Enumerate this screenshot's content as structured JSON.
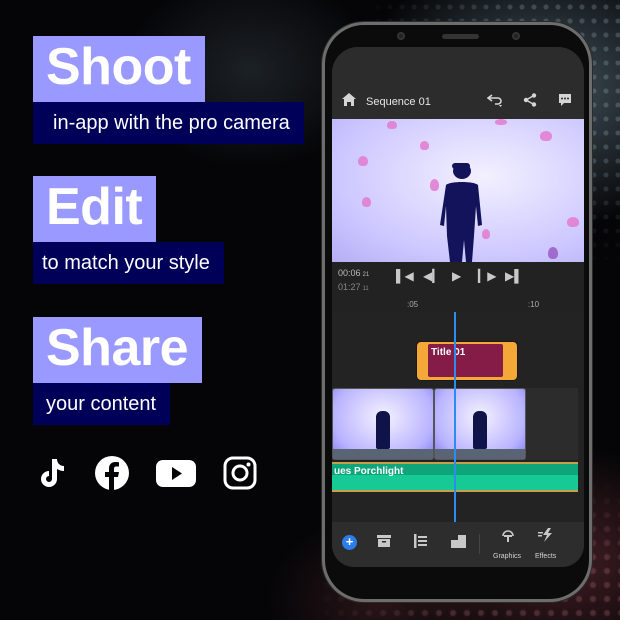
{
  "promo": {
    "shoot": {
      "headline": "Shoot",
      "sub": "in-app with the pro camera"
    },
    "edit": {
      "headline": "Edit",
      "sub": "to match your style"
    },
    "share": {
      "headline": "Share",
      "sub": "your content"
    },
    "social_icons": [
      "tiktok-icon",
      "facebook-icon",
      "youtube-icon",
      "instagram-icon"
    ],
    "colors": {
      "headline_bg": "#9999ff",
      "sub_bg": "#000059"
    }
  },
  "app": {
    "header": {
      "title": "Sequence 01"
    },
    "playback": {
      "current_time": "00:06",
      "current_frame": "21",
      "duration": "01:27",
      "duration_frame": "11"
    },
    "ruler": [
      ":05",
      ":10"
    ],
    "timeline": {
      "title_clip": "Title 01",
      "audio_clip": "ues Porchlight"
    },
    "toolbar": {
      "graphics_label": "Graphics",
      "effects_label": "Effects"
    },
    "colors": {
      "accent": "#2b7de9",
      "title_clip": "#f4a838",
      "audio": "#16c995"
    }
  }
}
